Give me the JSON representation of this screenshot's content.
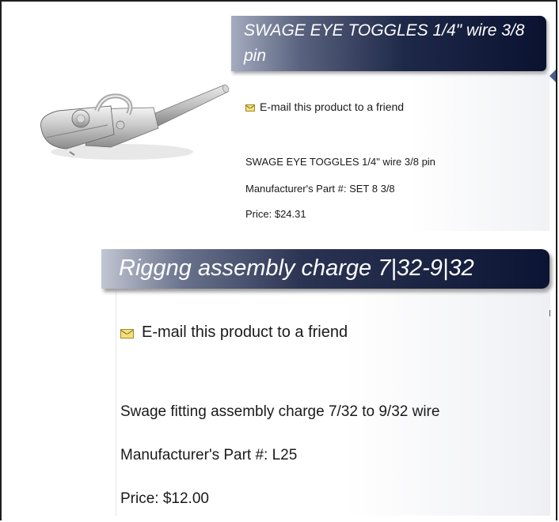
{
  "products": [
    {
      "title": "SWAGE EYE TOGGLES 1/4\" wire 3/8 pin",
      "email_link": "E-mail this product to a friend",
      "description": "SWAGE EYE TOGGLES 1/4\" wire 3/8 pin",
      "part_number": "Manufacturer's Part #: SET 8 3/8",
      "price": "Price: $24.31"
    },
    {
      "title": "Riggng assembly charge 7|32-9|32",
      "email_link": "E-mail this product to a friend",
      "description": "Swage fitting assembly charge 7/32 to 9/32 wire",
      "part_number": "Manufacturer's Part #: L25",
      "price": "Price: $12.00"
    }
  ],
  "icons": {
    "email": "envelope-icon",
    "product_image": "swage-eye-toggle-image"
  },
  "colors": {
    "title_bar_dark": "#0a1230",
    "title_bar_light": "#a5acc0",
    "envelope": "#f4e07a"
  }
}
